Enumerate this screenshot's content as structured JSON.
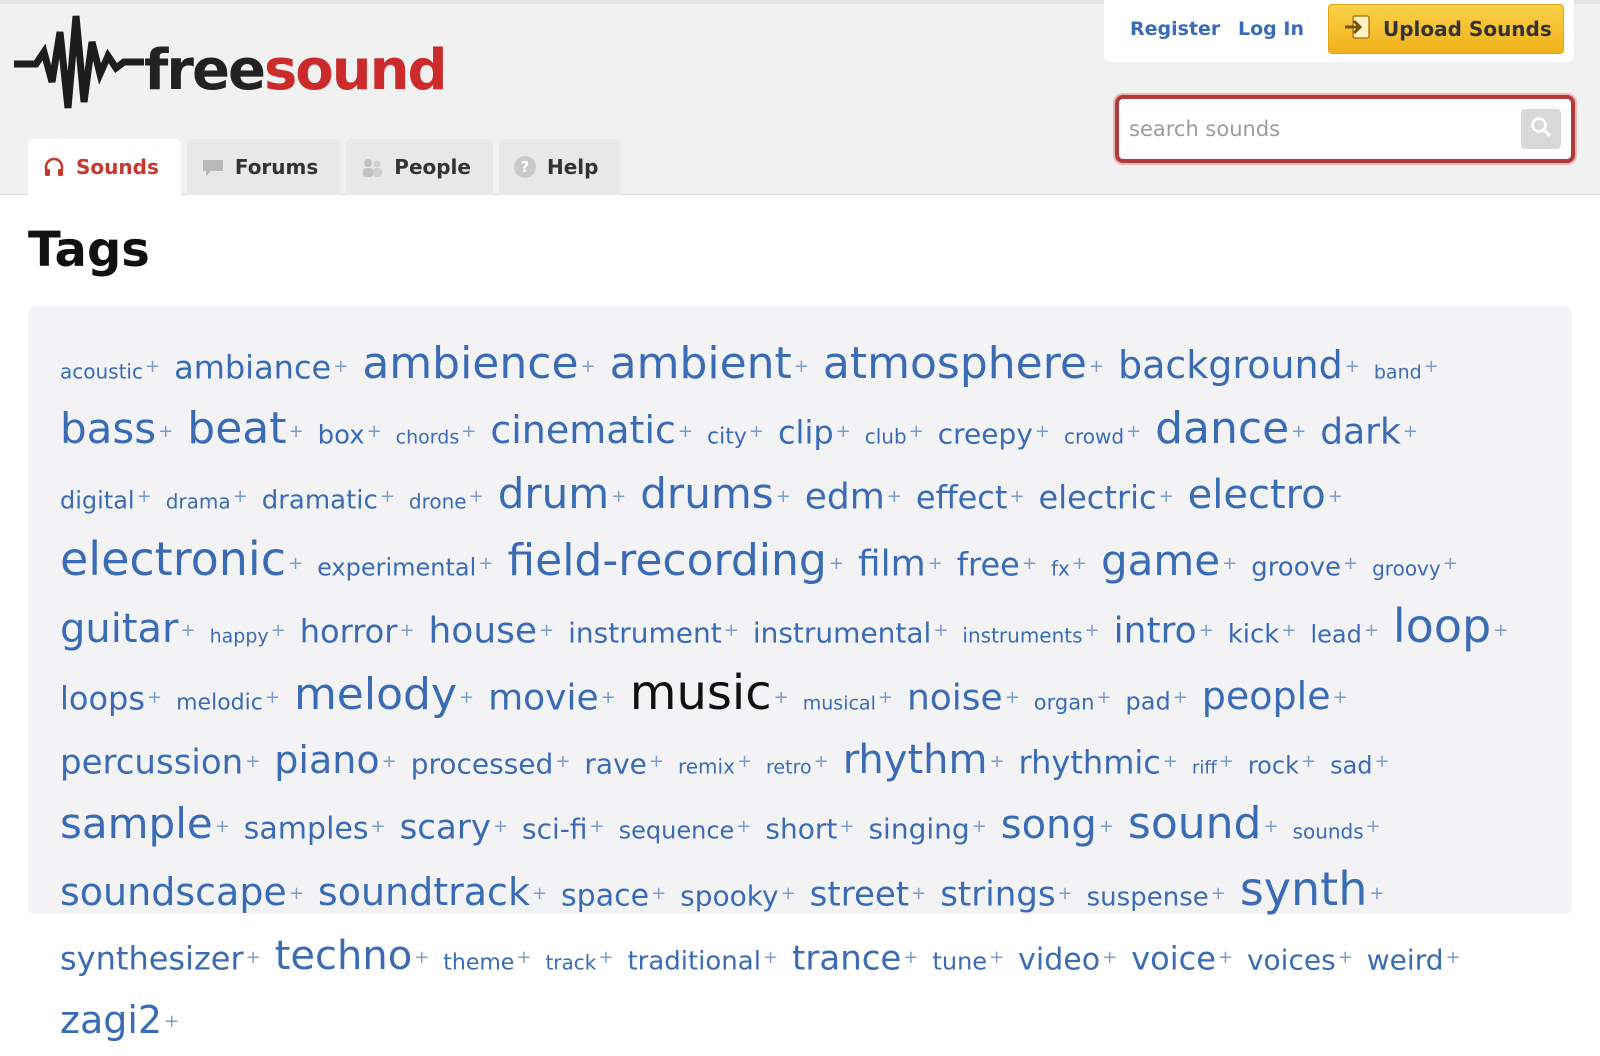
{
  "brand": {
    "free": "free",
    "sound": "sound",
    "accent": "#cc2b2b",
    "link": "#3a6cb5"
  },
  "nav": {
    "tabs": [
      {
        "label": "Sounds",
        "icon": "headphones-icon",
        "active": true
      },
      {
        "label": "Forums",
        "icon": "speech-bubble-icon",
        "active": false
      },
      {
        "label": "People",
        "icon": "people-icon",
        "active": false
      },
      {
        "label": "Help",
        "icon": "question-icon",
        "active": false
      }
    ]
  },
  "account": {
    "register": "Register",
    "login": "Log In",
    "upload": "Upload Sounds"
  },
  "search": {
    "placeholder": "search sounds"
  },
  "page": {
    "title": "Tags"
  },
  "tags": [
    {
      "t": "acoustic",
      "s": 20
    },
    {
      "t": "ambiance",
      "s": 32
    },
    {
      "t": "ambience",
      "s": 44
    },
    {
      "t": "ambient",
      "s": 44
    },
    {
      "t": "atmosphere",
      "s": 44
    },
    {
      "t": "background",
      "s": 38
    },
    {
      "t": "band",
      "s": 19
    },
    {
      "t": "bass",
      "s": 42
    },
    {
      "t": "beat",
      "s": 44
    },
    {
      "t": "box",
      "s": 26
    },
    {
      "t": "chords",
      "s": 19
    },
    {
      "t": "cinematic",
      "s": 38
    },
    {
      "t": "city",
      "s": 22
    },
    {
      "t": "clip",
      "s": 32
    },
    {
      "t": "club",
      "s": 20
    },
    {
      "t": "creepy",
      "s": 28
    },
    {
      "t": "crowd",
      "s": 20
    },
    {
      "t": "dance",
      "s": 44
    },
    {
      "t": "dark",
      "s": 36
    },
    {
      "t": "digital",
      "s": 24
    },
    {
      "t": "drama",
      "s": 20
    },
    {
      "t": "dramatic",
      "s": 26
    },
    {
      "t": "drone",
      "s": 20
    },
    {
      "t": "drum",
      "s": 42
    },
    {
      "t": "drums",
      "s": 42
    },
    {
      "t": "edm",
      "s": 36
    },
    {
      "t": "effect",
      "s": 32
    },
    {
      "t": "electric",
      "s": 32
    },
    {
      "t": "electro",
      "s": 40
    },
    {
      "t": "electronic",
      "s": 46
    },
    {
      "t": "experimental",
      "s": 24
    },
    {
      "t": "field-recording",
      "s": 44
    },
    {
      "t": "film",
      "s": 36
    },
    {
      "t": "free",
      "s": 32
    },
    {
      "t": "fx",
      "s": 20
    },
    {
      "t": "game",
      "s": 42
    },
    {
      "t": "groove",
      "s": 26
    },
    {
      "t": "groovy",
      "s": 20
    },
    {
      "t": "guitar",
      "s": 40
    },
    {
      "t": "happy",
      "s": 19
    },
    {
      "t": "horror",
      "s": 32
    },
    {
      "t": "house",
      "s": 36
    },
    {
      "t": "instrument",
      "s": 28
    },
    {
      "t": "instrumental",
      "s": 28
    },
    {
      "t": "instruments",
      "s": 20
    },
    {
      "t": "intro",
      "s": 36
    },
    {
      "t": "kick",
      "s": 26
    },
    {
      "t": "lead",
      "s": 24
    },
    {
      "t": "loop",
      "s": 46
    },
    {
      "t": "loops",
      "s": 32
    },
    {
      "t": "melodic",
      "s": 22
    },
    {
      "t": "melody",
      "s": 44
    },
    {
      "t": "movie",
      "s": 36
    },
    {
      "t": "music",
      "s": 48,
      "dark": true
    },
    {
      "t": "musical",
      "s": 19
    },
    {
      "t": "noise",
      "s": 36
    },
    {
      "t": "organ",
      "s": 21
    },
    {
      "t": "pad",
      "s": 24
    },
    {
      "t": "people",
      "s": 38
    },
    {
      "t": "percussion",
      "s": 34
    },
    {
      "t": "piano",
      "s": 38
    },
    {
      "t": "processed",
      "s": 28
    },
    {
      "t": "rave",
      "s": 28
    },
    {
      "t": "remix",
      "s": 20
    },
    {
      "t": "retro",
      "s": 19
    },
    {
      "t": "rhythm",
      "s": 40
    },
    {
      "t": "rhythmic",
      "s": 32
    },
    {
      "t": "riff",
      "s": 18
    },
    {
      "t": "rock",
      "s": 24
    },
    {
      "t": "sad",
      "s": 24
    },
    {
      "t": "sample",
      "s": 42
    },
    {
      "t": "samples",
      "s": 30
    },
    {
      "t": "scary",
      "s": 34
    },
    {
      "t": "sci-fi",
      "s": 28
    },
    {
      "t": "sequence",
      "s": 24
    },
    {
      "t": "short",
      "s": 28
    },
    {
      "t": "singing",
      "s": 28
    },
    {
      "t": "song",
      "s": 40
    },
    {
      "t": "sound",
      "s": 44
    },
    {
      "t": "sounds",
      "s": 20
    },
    {
      "t": "soundscape",
      "s": 38
    },
    {
      "t": "soundtrack",
      "s": 38
    },
    {
      "t": "space",
      "s": 30
    },
    {
      "t": "spooky",
      "s": 28
    },
    {
      "t": "street",
      "s": 34
    },
    {
      "t": "strings",
      "s": 34
    },
    {
      "t": "suspense",
      "s": 26
    },
    {
      "t": "synth",
      "s": 46
    },
    {
      "t": "synthesizer",
      "s": 32
    },
    {
      "t": "techno",
      "s": 40
    },
    {
      "t": "theme",
      "s": 22
    },
    {
      "t": "track",
      "s": 20
    },
    {
      "t": "traditional",
      "s": 26
    },
    {
      "t": "trance",
      "s": 34
    },
    {
      "t": "tune",
      "s": 24
    },
    {
      "t": "video",
      "s": 30
    },
    {
      "t": "voice",
      "s": 32
    },
    {
      "t": "voices",
      "s": 28
    },
    {
      "t": "weird",
      "s": 28
    },
    {
      "t": "zagi2",
      "s": 38
    }
  ]
}
